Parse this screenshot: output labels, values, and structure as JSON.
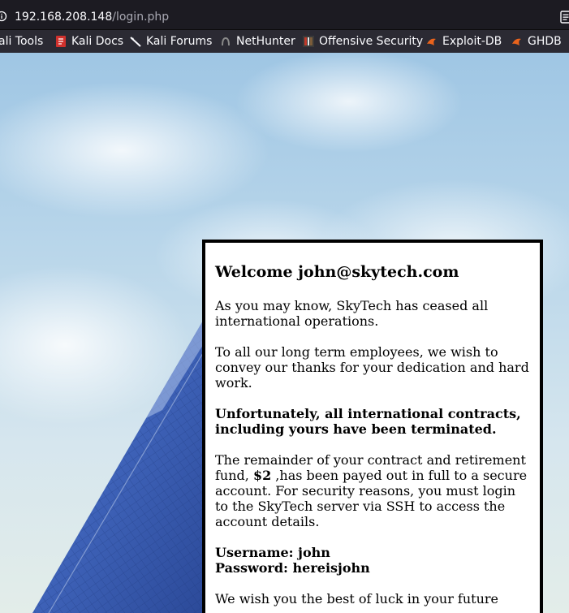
{
  "browser": {
    "url_host": "192.168.208.148",
    "url_path": "/login.php",
    "bookmarks": [
      {
        "label": "ali Tools",
        "icon": "kali-tools-icon"
      },
      {
        "label": "Kali Docs",
        "icon": "kali-docs-icon"
      },
      {
        "label": "Kali Forums",
        "icon": "kali-forums-icon"
      },
      {
        "label": "NetHunter",
        "icon": "nethunter-icon"
      },
      {
        "label": "Offensive Security",
        "icon": "offensive-security-icon"
      },
      {
        "label": "Exploit-DB",
        "icon": "exploit-db-icon"
      },
      {
        "label": "GHDB",
        "icon": "ghdb-icon"
      }
    ]
  },
  "message": {
    "heading": "Welcome john@skytech.com",
    "para1": "As you may know, SkyTech has ceased all international operations.",
    "para2": "To all our long term employees, we wish to convey our thanks for your dedication and hard work.",
    "para3": "Unfortunately, all international contracts, including yours have been terminated.",
    "para4_before": "The remainder of your contract and retirement fund, ",
    "para4_amount": "$2",
    "para4_after": " ,has been payed out in full to a secure account. For security reasons, you must login to the SkyTech server via SSH to access the account details.",
    "username_line": "Username: john",
    "password_line": "Password: hereisjohn",
    "closing": "We wish you the best of luck in your future"
  }
}
